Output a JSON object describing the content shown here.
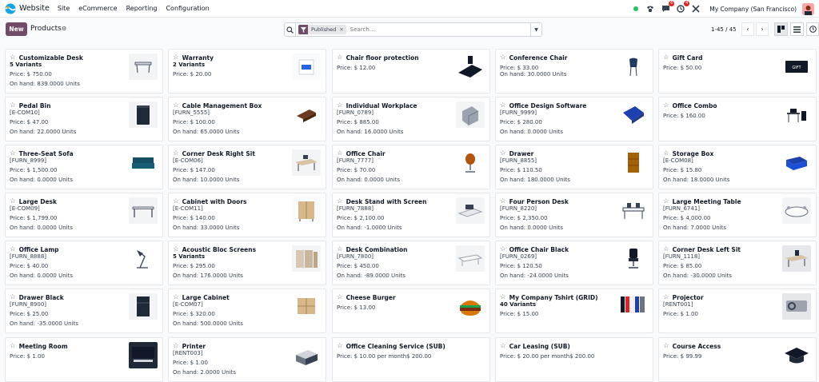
{
  "navbar": {
    "app_name": "Website",
    "menu": [
      "Site",
      "eCommerce",
      "Reporting",
      "Configuration"
    ],
    "messages_badge": "6",
    "activities_badge": "4",
    "company": "My Company (San Francisco)"
  },
  "control": {
    "new_label": "New",
    "title": "Products",
    "facet_label": "Published",
    "search_placeholder": "Search...",
    "pager": "1-45 / 45"
  },
  "cards": [
    {
      "name": "Customizable Desk",
      "sub": "5 Variants",
      "sub_bold": true,
      "price": "Price: $ 750.00",
      "onhand": "On hand: 839.0000 Units",
      "icon": "desk-icon"
    },
    {
      "name": "Warranty",
      "sub": "2 Variants",
      "sub_bold": true,
      "price": "Price: $ 20.00",
      "onhand": "",
      "icon": "warranty-box-icon"
    },
    {
      "name": "Chair floor protection",
      "sub": "",
      "price": "Price: $ 12.00",
      "onhand": "",
      "icon": "floor-mat-icon"
    },
    {
      "name": "Conference Chair",
      "sub": "",
      "price": "Price: $ 33.00",
      "onhand": "On hand: 30.0000 Units",
      "icon": "chair-icon"
    },
    {
      "name": "Gift Card",
      "sub": "",
      "price": "Price: $ 50.00",
      "onhand": "",
      "icon": "gift-card-icon"
    },
    {
      "name": "Pedal Bin",
      "sub": "[E-COM10]",
      "price": "Price: $ 47.00",
      "onhand": "On hand: 22.0000 Units",
      "icon": "bin-icon"
    },
    {
      "name": "Cable Management Box",
      "sub": "[FURN_5555]",
      "price": "Price: $ 100.00",
      "onhand": "On hand: 65.0000 Units",
      "icon": "cable-box-icon"
    },
    {
      "name": "Individual Workplace",
      "sub": "[FURN_0789]",
      "price": "Price: $ 885.00",
      "onhand": "On hand: 16.0000 Units",
      "icon": "workplace-icon"
    },
    {
      "name": "Office Design Software",
      "sub": "[FURN_9999]",
      "price": "Price: $ 280.00",
      "onhand": "On hand: 0.0000 Units",
      "icon": "software-box-icon"
    },
    {
      "name": "Office Combo",
      "sub": "",
      "price": "Price: $ 160.00",
      "onhand": "",
      "icon": "office-combo-icon"
    },
    {
      "name": "Three-Seat Sofa",
      "sub": "[FURN_8999]",
      "price": "Price: $ 1,500.00",
      "onhand": "On hand: 0.0000 Units",
      "icon": "sofa-icon"
    },
    {
      "name": "Corner Desk Right Sit",
      "sub": "[E-COM06]",
      "price": "Price: $ 147.00",
      "onhand": "On hand: 10.0000 Units",
      "icon": "corner-desk-icon"
    },
    {
      "name": "Office Chair",
      "sub": "[FURN_7777]",
      "price": "Price: $ 70.00",
      "onhand": "On hand: 0.0000 Units",
      "icon": "office-chair-icon"
    },
    {
      "name": "Drawer",
      "sub": "[FURN_8855]",
      "price": "Price: $ 110.50",
      "onhand": "On hand: 180.0000 Units",
      "icon": "drawer-icon"
    },
    {
      "name": "Storage Box",
      "sub": "[E-COM08]",
      "price": "Price: $ 15.80",
      "onhand": "On hand: 18.0000 Units",
      "icon": "storage-box-icon"
    },
    {
      "name": "Large Desk",
      "sub": "[E-COM09]",
      "price": "Price: $ 1,799.00",
      "onhand": "On hand: 0.0000 Units",
      "icon": "large-desk-icon"
    },
    {
      "name": "Cabinet with Doors",
      "sub": "[E-COM11]",
      "price": "Price: $ 140.00",
      "onhand": "On hand: 33.0000 Units",
      "icon": "cabinet-icon"
    },
    {
      "name": "Desk Stand with Screen",
      "sub": "[FURN_7888]",
      "price": "Price: $ 2,100.00",
      "onhand": "On hand: -1.0000 Units",
      "icon": "desk-stand-icon"
    },
    {
      "name": "Four Person Desk",
      "sub": "[FURN_8220]",
      "price": "Price: $ 2,350.00",
      "onhand": "On hand: 0.0000 Units",
      "icon": "four-person-desk-icon"
    },
    {
      "name": "Large Meeting Table",
      "sub": "[FURN_6741]",
      "price": "Price: $ 4,000.00",
      "onhand": "On hand: 7.0000 Units",
      "icon": "meeting-table-icon"
    },
    {
      "name": "Office Lamp",
      "sub": "[FURN_8888]",
      "price": "Price: $ 40.00",
      "onhand": "On hand: 0.0000 Units",
      "icon": "lamp-icon"
    },
    {
      "name": "Acoustic Bloc Screens",
      "sub": "5 Variants",
      "sub_bold": true,
      "price": "Price: $ 295.00",
      "onhand": "On hand: 176.0000 Units",
      "icon": "screens-icon"
    },
    {
      "name": "Desk Combination",
      "sub": "[FURN_7800]",
      "price": "Price: $ 450.00",
      "onhand": "On hand: -89.0000 Units",
      "icon": "desk-combination-icon"
    },
    {
      "name": "Office Chair Black",
      "sub": "[FURN_0269]",
      "price": "Price: $ 120.50",
      "onhand": "On hand: -24.0000 Units",
      "icon": "black-chair-icon"
    },
    {
      "name": "Corner Desk Left Sit",
      "sub": "[FURN_1118]",
      "price": "Price: $ 85.00",
      "onhand": "On hand: -30.0000 Units",
      "icon": "corner-desk-left-icon"
    },
    {
      "name": "Drawer Black",
      "sub": "[FURN_8900]",
      "price": "Price: $ 25.00",
      "onhand": "On hand: -35.0000 Units",
      "icon": "black-drawer-icon"
    },
    {
      "name": "Large Cabinet",
      "sub": "[E-COM07]",
      "price": "Price: $ 320.00",
      "onhand": "On hand: 500.0000 Units",
      "icon": "large-cabinet-icon"
    },
    {
      "name": "Cheese Burger",
      "sub": "",
      "price": "Price: $ 13.00",
      "onhand": "",
      "icon": "burger-icon"
    },
    {
      "name": "My Company Tshirt (GRID)",
      "sub": "40 Variants",
      "sub_bold": true,
      "price": "Price: $ 15.00",
      "onhand": "",
      "icon": "tshirts-icon"
    },
    {
      "name": "Projector",
      "sub": "[RENT001]",
      "price": "Price: $ 1.00",
      "onhand": "",
      "icon": "projector-icon"
    },
    {
      "name": "Meeting Room",
      "sub": "",
      "price": "Price: $ 1.00",
      "onhand": "",
      "icon": "meeting-room-icon"
    },
    {
      "name": "Printer",
      "sub": "[RENT003]",
      "price": "Price: $ 1.00",
      "onhand": "On hand: 2.0000 Units",
      "icon": "printer-icon"
    },
    {
      "name": "Office Cleaning Service (SUB)",
      "sub": "",
      "price": "Price: $ 10.00 per month$ 200.00",
      "onhand": "",
      "icon": ""
    },
    {
      "name": "Car Leasing (SUB)",
      "sub": "",
      "price": "Price: $ 20.00 per month$ 200.00",
      "onhand": "",
      "icon": ""
    },
    {
      "name": "Course Access",
      "sub": "",
      "price": "Price: $ 99.99",
      "onhand": "",
      "icon": "graduation-cap-icon"
    }
  ]
}
